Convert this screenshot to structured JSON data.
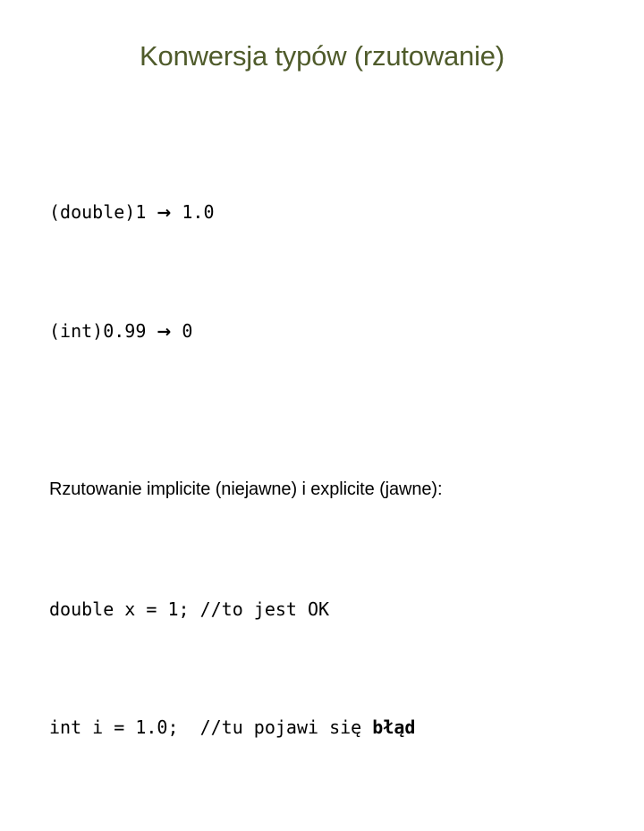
{
  "slide": {
    "title": "Konwersja typów (rzutowanie)",
    "title_color": "#4f5b2b",
    "background_color": "#ffffff",
    "body_text_color": "#000000"
  },
  "conversion_examples": {
    "lines": [
      {
        "source": "(double)1",
        "arrow": "→",
        "result": "1.0",
        "full_text": "(double)1 → 1.0"
      },
      {
        "source": "(int)0.99",
        "arrow": "→",
        "result": "0",
        "full_text": "(int)0.99 → 0"
      }
    ]
  },
  "explanation": {
    "heading": "Rzutowanie implicite (niejawne) i explicite (jawne):",
    "code_lines": [
      {
        "statement": "double x = 1;",
        "gap": " ",
        "comment": "//to jest OK",
        "emphasis": ""
      },
      {
        "statement": "int i = 1.0;",
        "gap": "  ",
        "comment": "//tu pojawi się ",
        "emphasis": "błąd"
      }
    ]
  }
}
